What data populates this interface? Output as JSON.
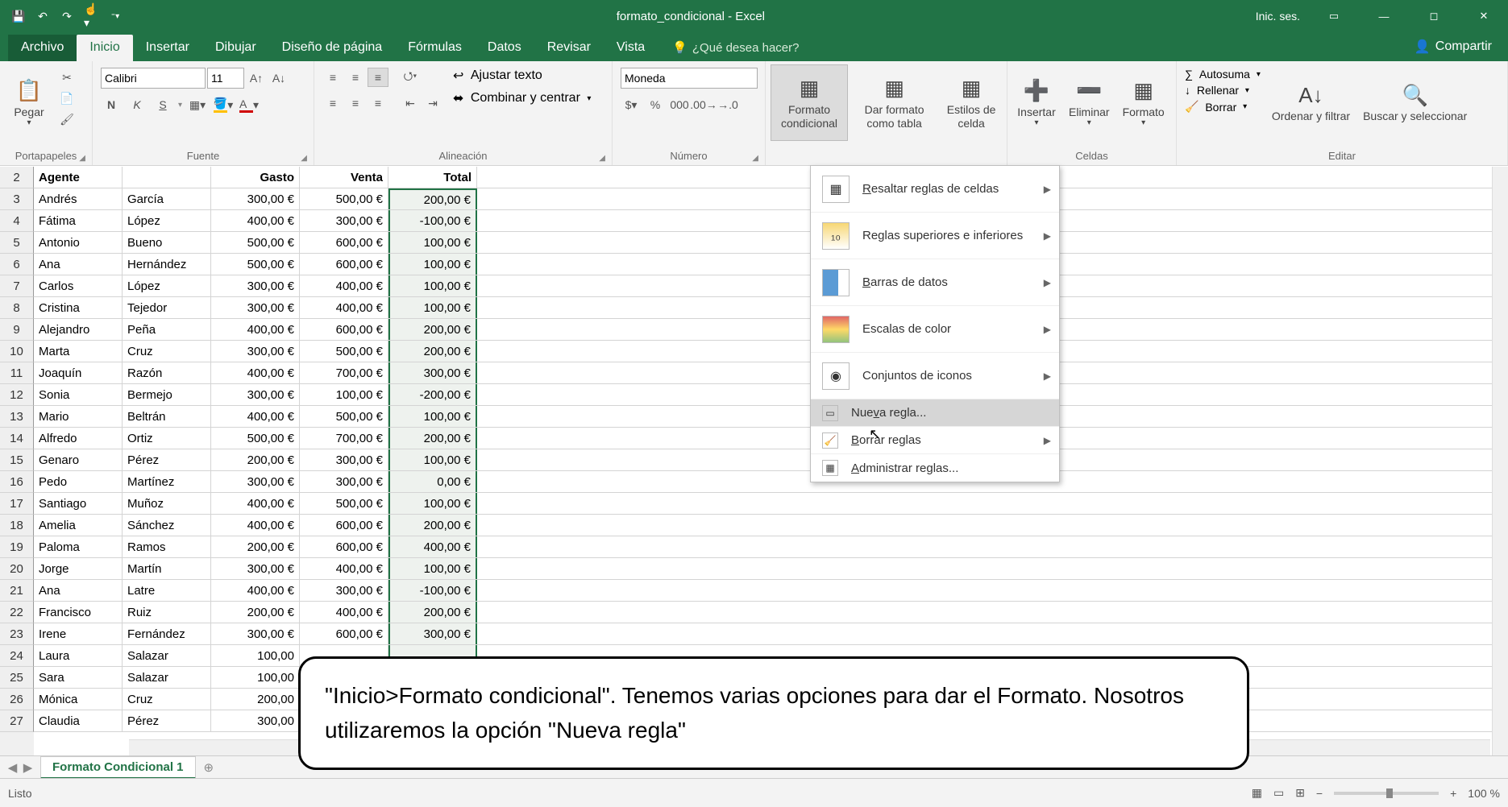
{
  "title": "formato_condicional - Excel",
  "signin": "Inic. ses.",
  "tabs": {
    "file": "Archivo",
    "home": "Inicio",
    "insert": "Insertar",
    "draw": "Dibujar",
    "layout": "Diseño de página",
    "formulas": "Fórmulas",
    "data": "Datos",
    "review": "Revisar",
    "view": "Vista"
  },
  "tellme": "¿Qué desea hacer?",
  "share": "Compartir",
  "ribbon": {
    "clipboard": {
      "label": "Portapapeles",
      "paste": "Pegar"
    },
    "font": {
      "label": "Fuente",
      "name": "Calibri",
      "size": "11",
      "bold": "N",
      "italic": "K",
      "underline": "S"
    },
    "alignment": {
      "label": "Alineación",
      "wrap": "Ajustar texto",
      "merge": "Combinar y centrar"
    },
    "number": {
      "label": "Número",
      "format": "Moneda"
    },
    "styles": {
      "cond": "Formato condicional",
      "table": "Dar formato como tabla",
      "cell": "Estilos de celda"
    },
    "cells": {
      "label": "Celdas",
      "insert": "Insertar",
      "delete": "Eliminar",
      "format": "Formato"
    },
    "editing": {
      "label": "Editar",
      "autosum": "Autosuma",
      "fill": "Rellenar",
      "clear": "Borrar",
      "sort": "Ordenar y filtrar",
      "find": "Buscar y seleccionar"
    }
  },
  "headers": {
    "agent": "Agente",
    "col2": "",
    "expense": "Gasto",
    "sale": "Venta",
    "total": "Total"
  },
  "rows": [
    {
      "n": "2",
      "a": "Agente",
      "b": "",
      "c": "Gasto",
      "d": "Venta",
      "e": "Total",
      "hdr": true
    },
    {
      "n": "3",
      "a": "Andrés",
      "b": "García",
      "c": "300,00 €",
      "d": "500,00 €",
      "e": "200,00 €"
    },
    {
      "n": "4",
      "a": "Fátima",
      "b": "López",
      "c": "400,00 €",
      "d": "300,00 €",
      "e": "-100,00 €"
    },
    {
      "n": "5",
      "a": "Antonio",
      "b": "Bueno",
      "c": "500,00 €",
      "d": "600,00 €",
      "e": "100,00 €"
    },
    {
      "n": "6",
      "a": "Ana",
      "b": "Hernández",
      "c": "500,00 €",
      "d": "600,00 €",
      "e": "100,00 €"
    },
    {
      "n": "7",
      "a": "Carlos",
      "b": "López",
      "c": "300,00 €",
      "d": "400,00 €",
      "e": "100,00 €"
    },
    {
      "n": "8",
      "a": "Cristina",
      "b": "Tejedor",
      "c": "300,00 €",
      "d": "400,00 €",
      "e": "100,00 €"
    },
    {
      "n": "9",
      "a": "Alejandro",
      "b": "Peña",
      "c": "400,00 €",
      "d": "600,00 €",
      "e": "200,00 €"
    },
    {
      "n": "10",
      "a": "Marta",
      "b": "Cruz",
      "c": "300,00 €",
      "d": "500,00 €",
      "e": "200,00 €"
    },
    {
      "n": "11",
      "a": "Joaquín",
      "b": "Razón",
      "c": "400,00 €",
      "d": "700,00 €",
      "e": "300,00 €"
    },
    {
      "n": "12",
      "a": "Sonia",
      "b": "Bermejo",
      "c": "300,00 €",
      "d": "100,00 €",
      "e": "-200,00 €"
    },
    {
      "n": "13",
      "a": "Mario",
      "b": "Beltrán",
      "c": "400,00 €",
      "d": "500,00 €",
      "e": "100,00 €"
    },
    {
      "n": "14",
      "a": "Alfredo",
      "b": "Ortiz",
      "c": "500,00 €",
      "d": "700,00 €",
      "e": "200,00 €"
    },
    {
      "n": "15",
      "a": "Genaro",
      "b": "Pérez",
      "c": "200,00 €",
      "d": "300,00 €",
      "e": "100,00 €"
    },
    {
      "n": "16",
      "a": "Pedo",
      "b": "Martínez",
      "c": "300,00 €",
      "d": "300,00 €",
      "e": "0,00 €"
    },
    {
      "n": "17",
      "a": "Santiago",
      "b": "Muñoz",
      "c": "400,00 €",
      "d": "500,00 €",
      "e": "100,00 €"
    },
    {
      "n": "18",
      "a": "Amelia",
      "b": "Sánchez",
      "c": "400,00 €",
      "d": "600,00 €",
      "e": "200,00 €"
    },
    {
      "n": "19",
      "a": "Paloma",
      "b": "Ramos",
      "c": "200,00 €",
      "d": "600,00 €",
      "e": "400,00 €"
    },
    {
      "n": "20",
      "a": "Jorge",
      "b": "Martín",
      "c": "300,00 €",
      "d": "400,00 €",
      "e": "100,00 €"
    },
    {
      "n": "21",
      "a": "Ana",
      "b": "Latre",
      "c": "400,00 €",
      "d": "300,00 €",
      "e": "-100,00 €"
    },
    {
      "n": "22",
      "a": "Francisco",
      "b": "Ruiz",
      "c": "200,00 €",
      "d": "400,00 €",
      "e": "200,00 €"
    },
    {
      "n": "23",
      "a": "Irene",
      "b": "Fernández",
      "c": "300,00 €",
      "d": "600,00 €",
      "e": "300,00 €"
    },
    {
      "n": "24",
      "a": "Laura",
      "b": "Salazar",
      "c": "100,00",
      "d": "",
      "e": ""
    },
    {
      "n": "25",
      "a": "Sara",
      "b": "Salazar",
      "c": "100,00",
      "d": "",
      "e": ""
    },
    {
      "n": "26",
      "a": "Mónica",
      "b": "Cruz",
      "c": "200,00",
      "d": "",
      "e": ""
    },
    {
      "n": "27",
      "a": "Claudia",
      "b": "Pérez",
      "c": "300,00",
      "d": "",
      "e": ""
    }
  ],
  "cfmenu": {
    "highlight": "Resaltar reglas de celdas",
    "topbottom": "Reglas superiores e inferiores",
    "databars": "Barras de datos",
    "colorscales": "Escalas de color",
    "iconsets": "Conjuntos de iconos",
    "newrule": "Nueva regla...",
    "clear": "Borrar reglas",
    "manage": "Administrar reglas..."
  },
  "sheet_tab": "Formato Condicional 1",
  "status_ready": "Listo",
  "zoom": "100 %",
  "callout": "\"Inicio>Formato condicional\". Tenemos varias opciones para dar el Formato. Nosotros utilizaremos la opción \"Nueva regla\""
}
